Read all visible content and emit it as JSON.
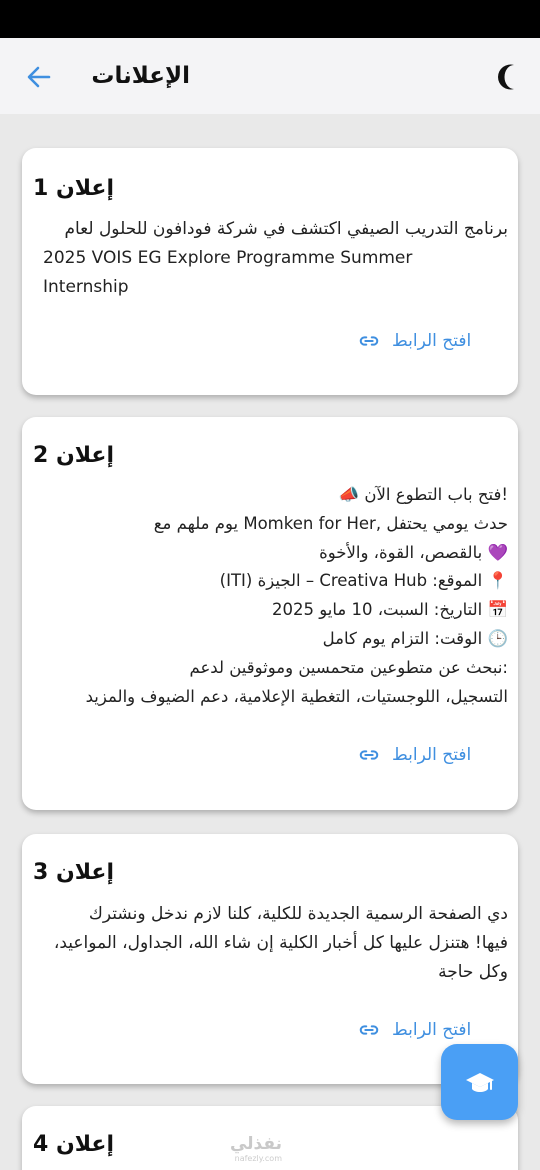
{
  "app_bar": {
    "title": "الإعلانات",
    "back_icon": "arrow-left-icon",
    "theme_icon": "moon-icon"
  },
  "announcements": [
    {
      "title": "إعلان 1",
      "lines": [
        "برنامج التدريب الصيفي اكتشف في شركة فودافون للحلول لعام",
        "2025 VOIS EG Explore Programme Summer",
        "Internship"
      ],
      "link_label": "افتح الرابط"
    },
    {
      "title": "إعلان 2",
      "lines": [
        "!فتح باب التطوع الآن 📣",
        "حدث يومي يحتفل ,Momken for Her يوم ملهم مع",
        "💜 بالقصص، القوة، والأخوة",
        "📍 الموقع: Creativa Hub – الجيزة (ITI)",
        "📅 التاريخ: السبت، 10 مايو 2025",
        "🕒 الوقت: التزام يوم كامل",
        ":نبحث عن متطوعين متحمسين وموثوقين لدعم",
        "التسجيل، اللوجستيات، التغطية الإعلامية، دعم الضيوف والمزيد"
      ],
      "link_label": "افتح الرابط"
    },
    {
      "title": "إعلان 3",
      "lines": [
        "دي الصفحة الرسمية الجديدة للكلية، كلنا لازم ندخل ونشترك",
        "فيها! هتنزل عليها كل أخبار الكلية إن شاء الله، الجداول، المواعيد،",
        "وكل حاجة"
      ],
      "link_label": "افتح الرابط"
    },
    {
      "title": "إعلان 4",
      "lines": [],
      "link_label": ""
    }
  ],
  "fab": {
    "icon": "graduation-cap-icon"
  },
  "watermark": {
    "text": "نفذلي",
    "sub": "nafezly.com"
  },
  "colors": {
    "accent": "#3f8fe0",
    "fab": "#4a9ff5",
    "background": "#e9e9e9",
    "card": "#ffffff"
  }
}
